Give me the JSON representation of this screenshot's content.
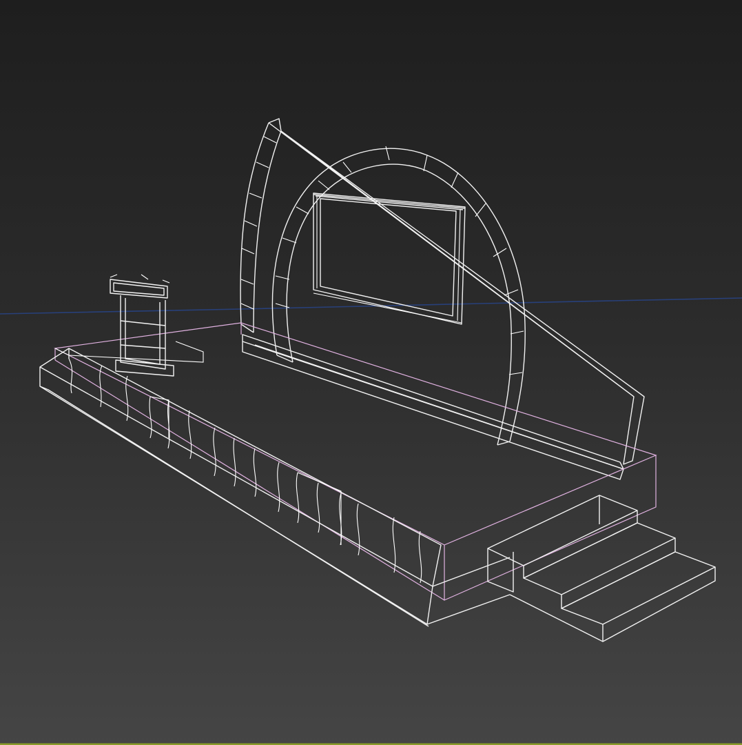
{
  "viewport": {
    "background_top": "#1e1e1e",
    "background_bottom": "#454545",
    "wire_color": "#f2f2f2",
    "selection_color": "#e2b3e2",
    "horizon_color": "#28407a",
    "objects": [
      "headstone-arc-slab",
      "ring-arch",
      "plaque-frame",
      "grave-base-slab",
      "curb-border",
      "flower-vase",
      "front-steps"
    ]
  }
}
